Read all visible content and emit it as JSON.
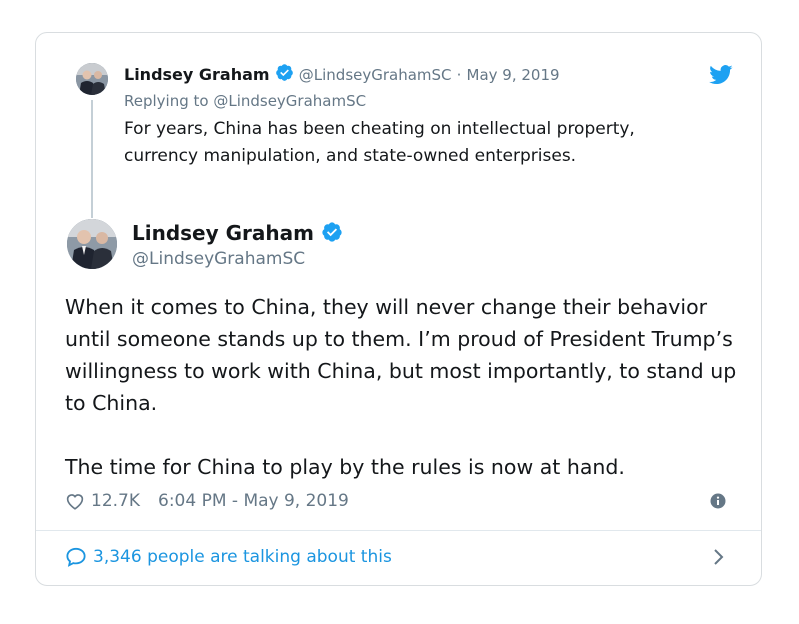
{
  "parent_tweet": {
    "author_name": "Lindsey Graham",
    "handle": "@LindseyGrahamSC",
    "separator": "·",
    "date": "May 9, 2019",
    "replying_to": "Replying to @LindseyGrahamSC",
    "text": "For years, China has been cheating on intellectual property, currency manipulation, and state-owned enterprises."
  },
  "main_tweet": {
    "author_name": "Lindsey Graham",
    "handle": "@LindseyGrahamSC",
    "paragraph_1": "When it comes to China, they will never change their behavior until someone stands up to them.  I’m proud of President Trump’s willingness to work with China, but most importantly, to stand up to China.",
    "paragraph_2": "The time for China to play by the rules is now at hand.",
    "likes": "12.7K",
    "timestamp": "6:04 PM - May 9, 2019"
  },
  "footer": {
    "talking": "3,346 people are talking about this"
  },
  "icons": {
    "verified": "verified-badge-icon",
    "bird": "twitter-bird-icon",
    "heart": "heart-icon",
    "info": "info-icon",
    "bubble": "speech-bubble-icon",
    "chevron": "chevron-right-icon"
  },
  "colors": {
    "accent": "#1b95e0",
    "verified": "#1da1f2",
    "muted": "#657786",
    "text": "#14171a"
  }
}
